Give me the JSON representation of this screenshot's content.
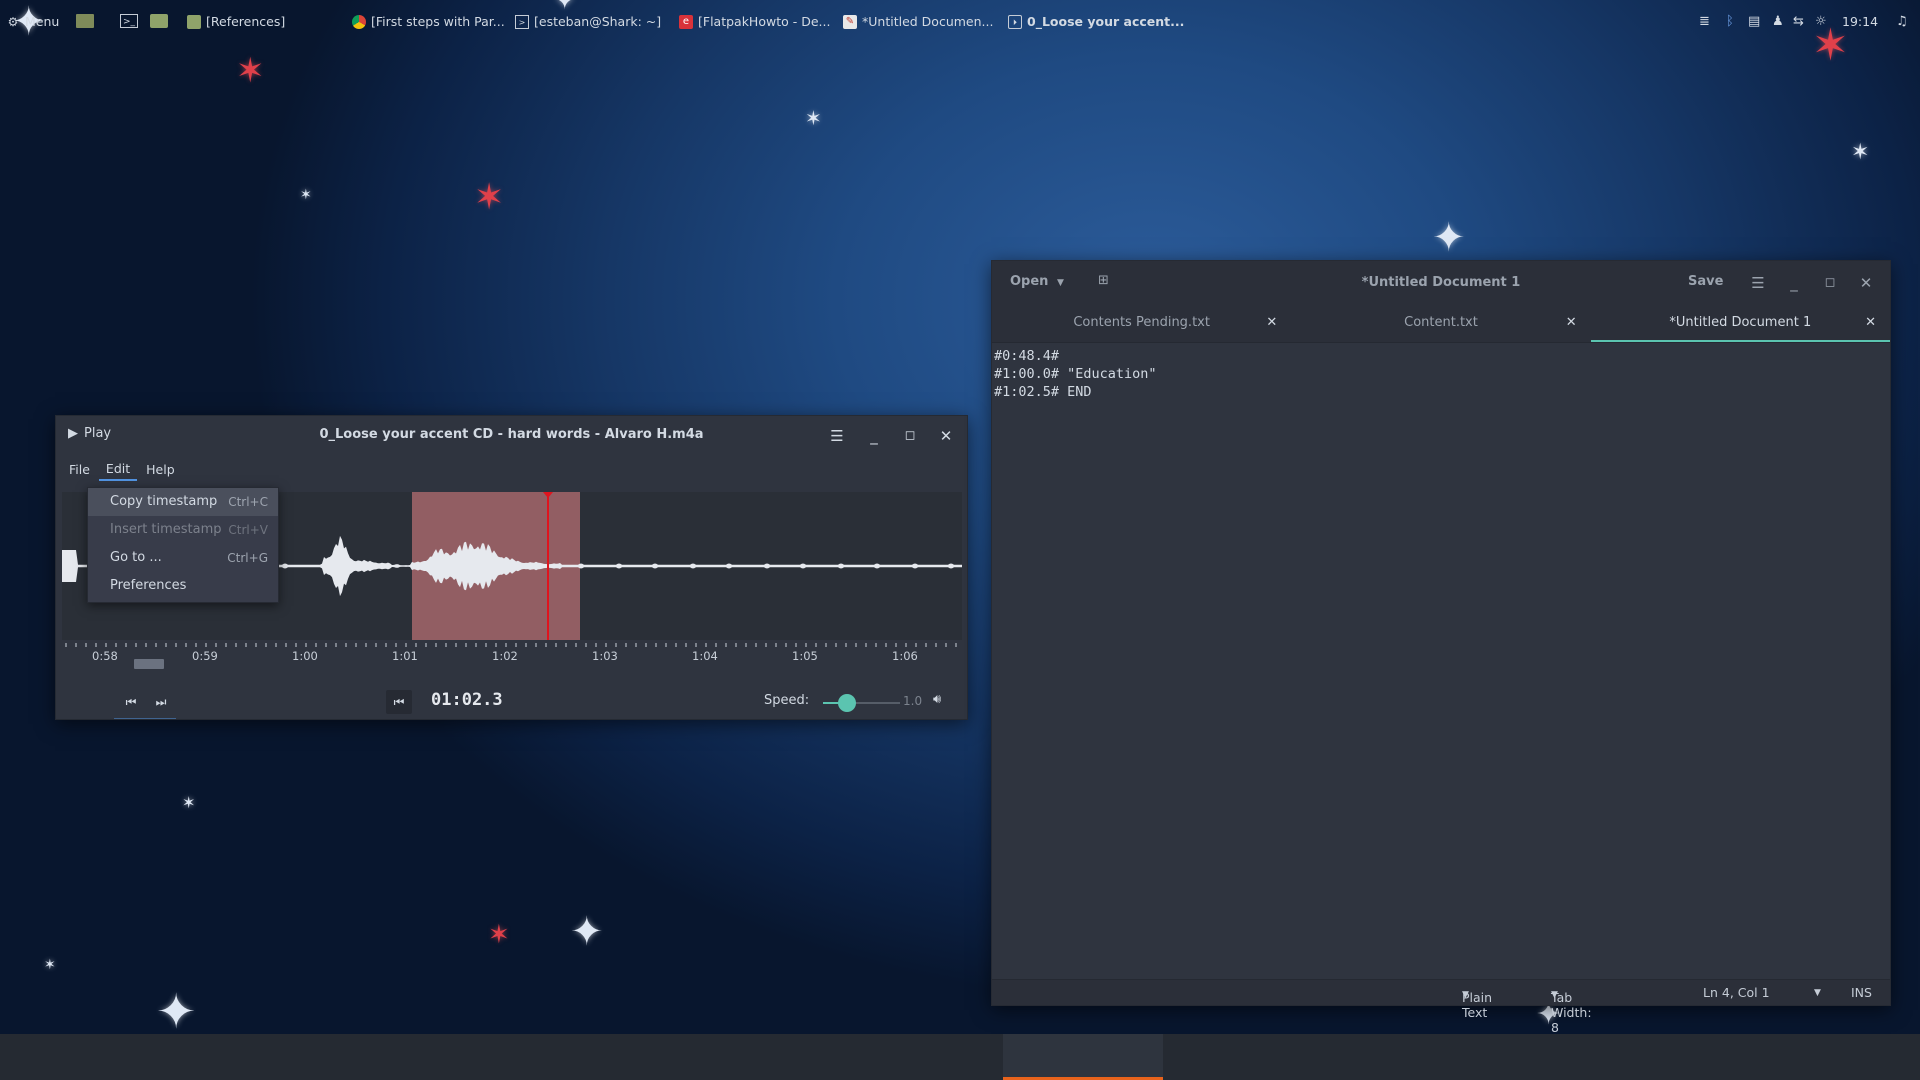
{
  "player": {
    "play_label": "Play",
    "title": "0_Loose your accent CD - hard words - Alvaro H.m4a",
    "menu": [
      "File",
      "Edit",
      "Help"
    ],
    "edit_menu": [
      {
        "label": "Copy timestamp",
        "shortcut": "Ctrl+C",
        "enabled": true
      },
      {
        "label": "Insert timestamp",
        "shortcut": "Ctrl+V",
        "enabled": false
      },
      {
        "label": "Go to ...",
        "shortcut": "Ctrl+G",
        "enabled": true
      },
      {
        "label": "Preferences",
        "shortcut": "",
        "enabled": true
      }
    ],
    "timeline_labels": [
      "0:58",
      "0:59",
      "1:00",
      "1:01",
      "1:02",
      "1:03",
      "1:04",
      "1:05",
      "1:06"
    ],
    "current_time": "01:02.3",
    "speed_label": "Speed:",
    "speed_value": "1.0"
  },
  "editor": {
    "open_label": "Open",
    "title": "*Untitled Document 1",
    "save_label": "Save",
    "tabs": [
      {
        "label": "Contents Pending.txt",
        "active": false
      },
      {
        "label": "Content.txt",
        "active": false
      },
      {
        "label": "*Untitled Document 1",
        "active": true
      }
    ],
    "lines": [
      "#0:48.4#",
      "#1:00.0# \"Education\"",
      "#1:02.5# END"
    ],
    "status": {
      "language": "Plain Text",
      "tab_width": "Tab Width: 8",
      "position": "Ln 4, Col 1",
      "mode": "INS"
    }
  },
  "taskbar": {
    "menu_label": "Menu",
    "items": [
      {
        "label": "[References]",
        "icon": "folder-icon"
      },
      {
        "label": "[First steps with Par...",
        "icon": "chrome-icon"
      },
      {
        "label": "[esteban@Shark: ~]",
        "icon": "terminal-icon"
      },
      {
        "label": "[FlatpakHowto - De...",
        "icon": "document-icon"
      },
      {
        "label": "*Untitled Documen...",
        "icon": "text-editor-icon"
      },
      {
        "label": "0_Loose your accent...",
        "icon": "audio-player-icon"
      }
    ],
    "clock": "19:14"
  },
  "colors": {
    "selection": "#b06b70",
    "playhead": "#e0141e",
    "accent": "#5bc4b0",
    "active_task": "#e8631c"
  }
}
